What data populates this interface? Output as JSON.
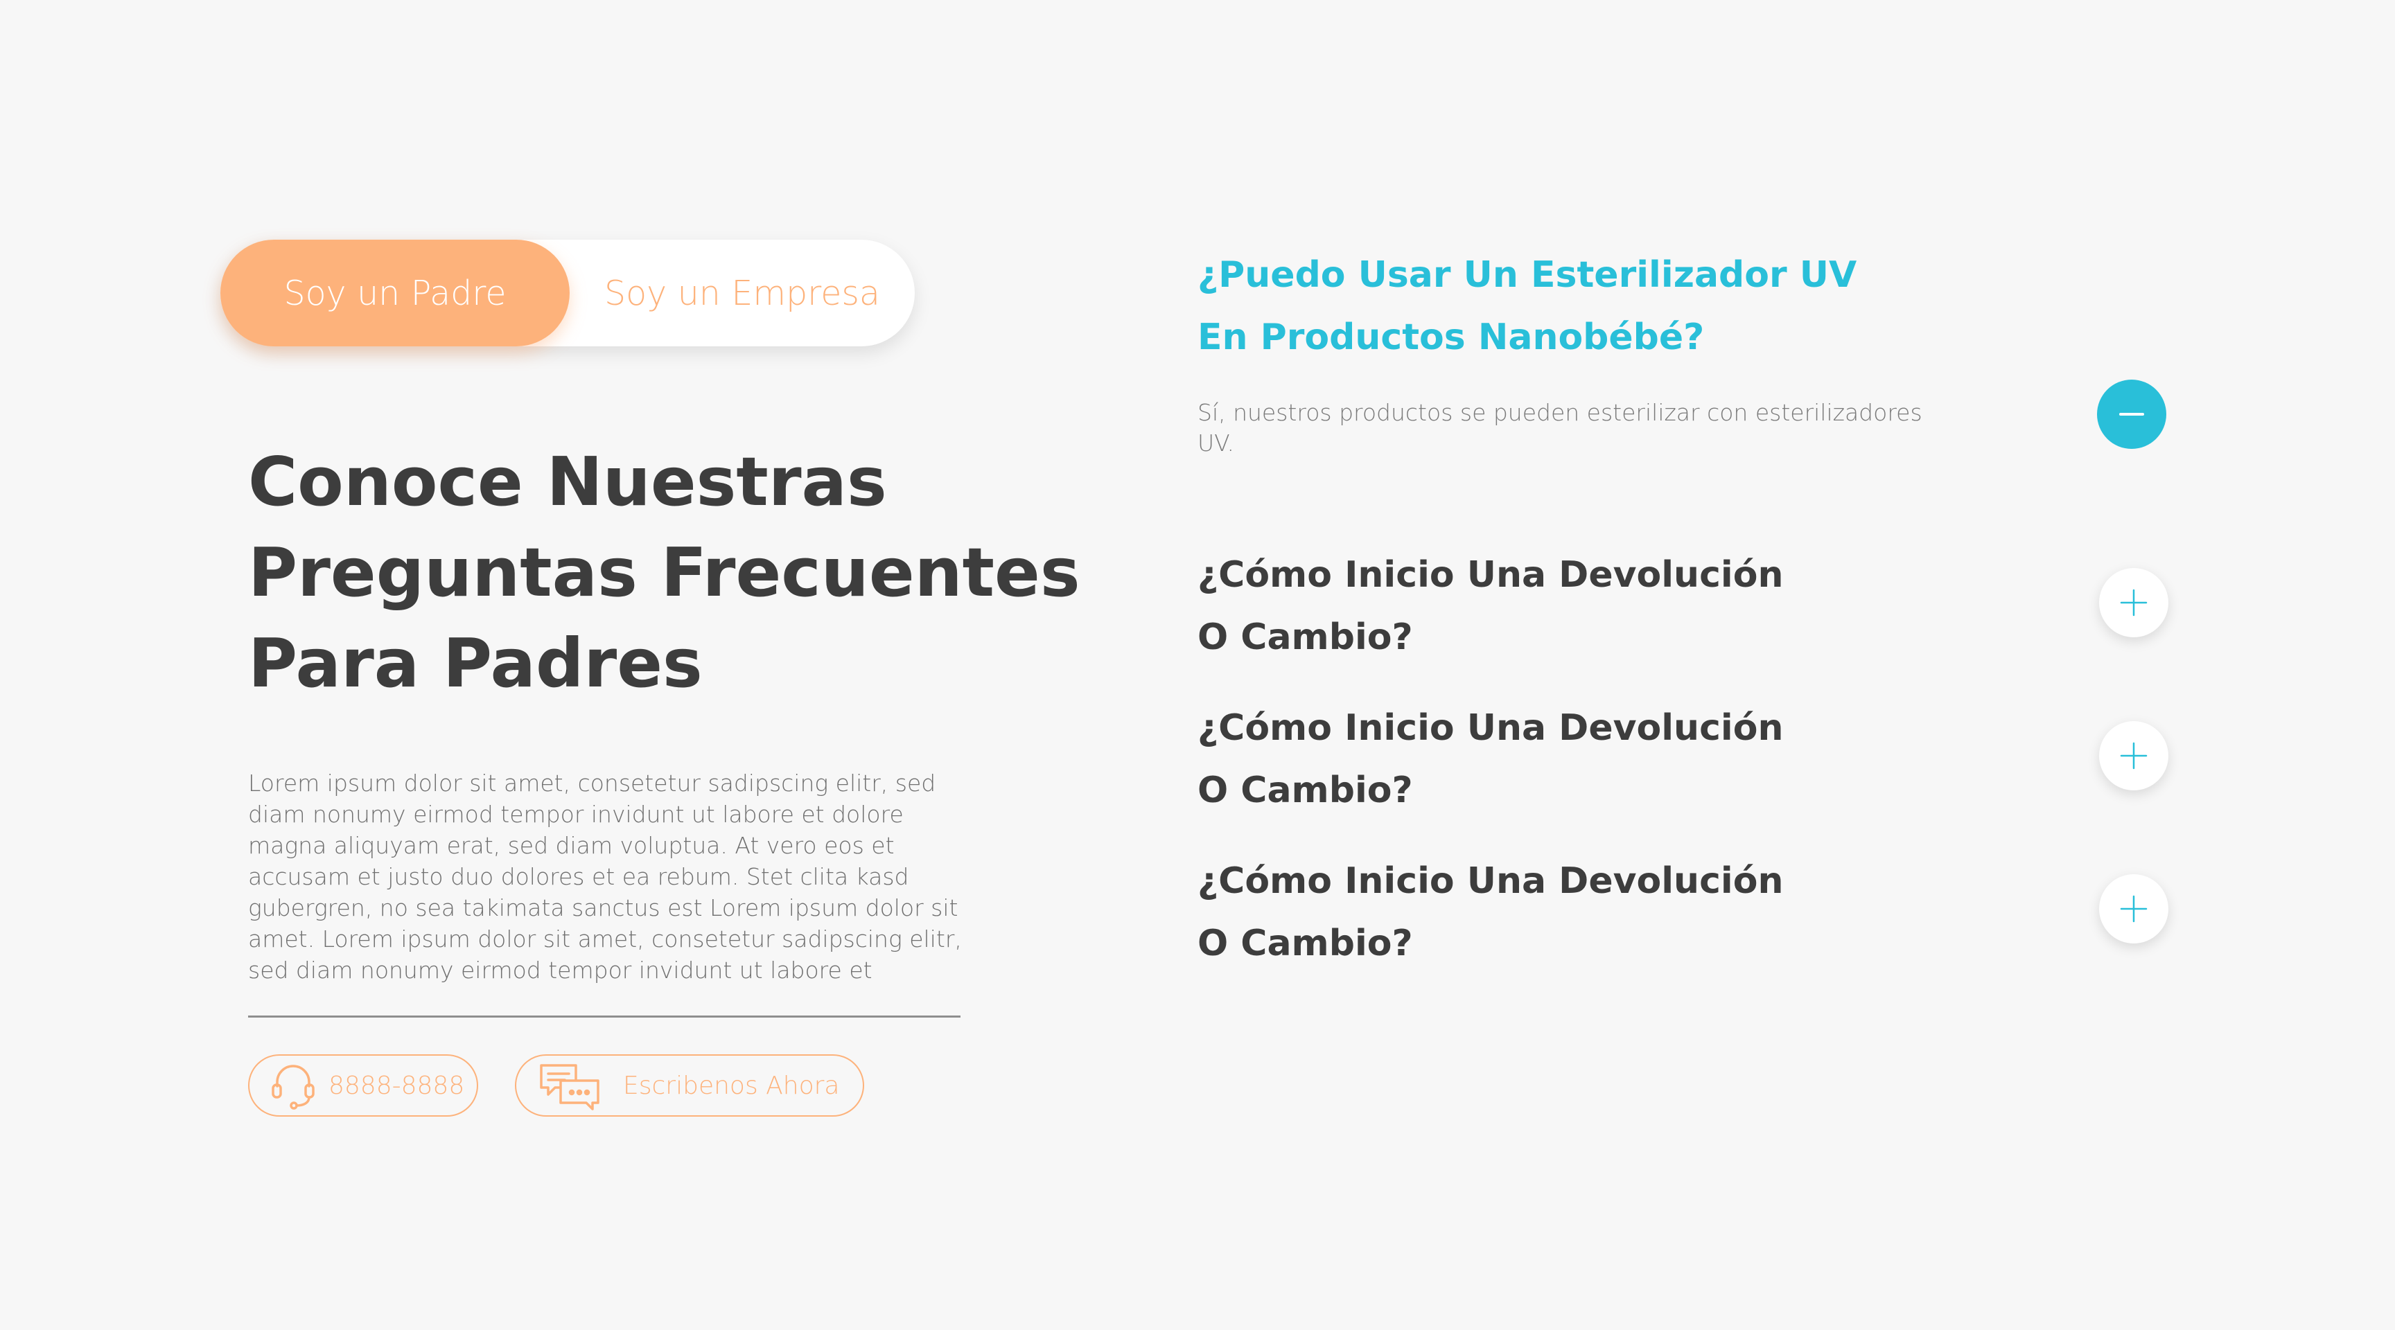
{
  "toggle": {
    "active_label": "Soy un Padre",
    "inactive_label": "Soy un Empresa"
  },
  "heading": {
    "line1": "Conoce Nuestras",
    "line2": "Preguntas Frecuentes",
    "line3": "Para Padres"
  },
  "intro_text": "Lorem ipsum dolor sit amet, consetetur sadipscing elitr, sed diam nonumy eirmod tempor invidunt ut labore et dolore magna aliquyam erat, sed diam voluptua. At vero eos et accusam et justo duo dolores et ea rebum. Stet clita kasd gubergren, no sea takimata sanctus est Lorem ipsum dolor sit amet. Lorem ipsum dolor sit amet, consetetur sadipscing elitr, sed diam nonumy eirmod tempor invidunt ut labore et",
  "contact": {
    "phone_label": "8888-8888",
    "phone_icon": "headset-icon",
    "chat_label": "Escribenos Ahora",
    "chat_icon": "chat-bubbles-icon"
  },
  "faq": {
    "open_item": {
      "question_line1": "¿Puedo Usar Un Esterilizador UV",
      "question_line2": "En Productos Nanobébé?",
      "answer": "Sí, nuestros productos se pueden esterilizar con esterilizadores UV.",
      "icon": "minus-icon"
    },
    "items": [
      {
        "question_line1": "¿Cómo Inicio Una Devolución",
        "question_line2": "O Cambio?",
        "icon": "plus-icon"
      },
      {
        "question_line1": "¿Cómo Inicio Una Devolución",
        "question_line2": "O Cambio?",
        "icon": "plus-icon"
      },
      {
        "question_line1": "¿Cómo Inicio Una Devolución",
        "question_line2": "O Cambio?",
        "icon": "plus-icon"
      }
    ]
  },
  "colors": {
    "accent_orange": "#fdb27b",
    "accent_cyan": "#29bfd9",
    "text_dark": "#3d3d3d",
    "background": "#f7f7f7"
  }
}
